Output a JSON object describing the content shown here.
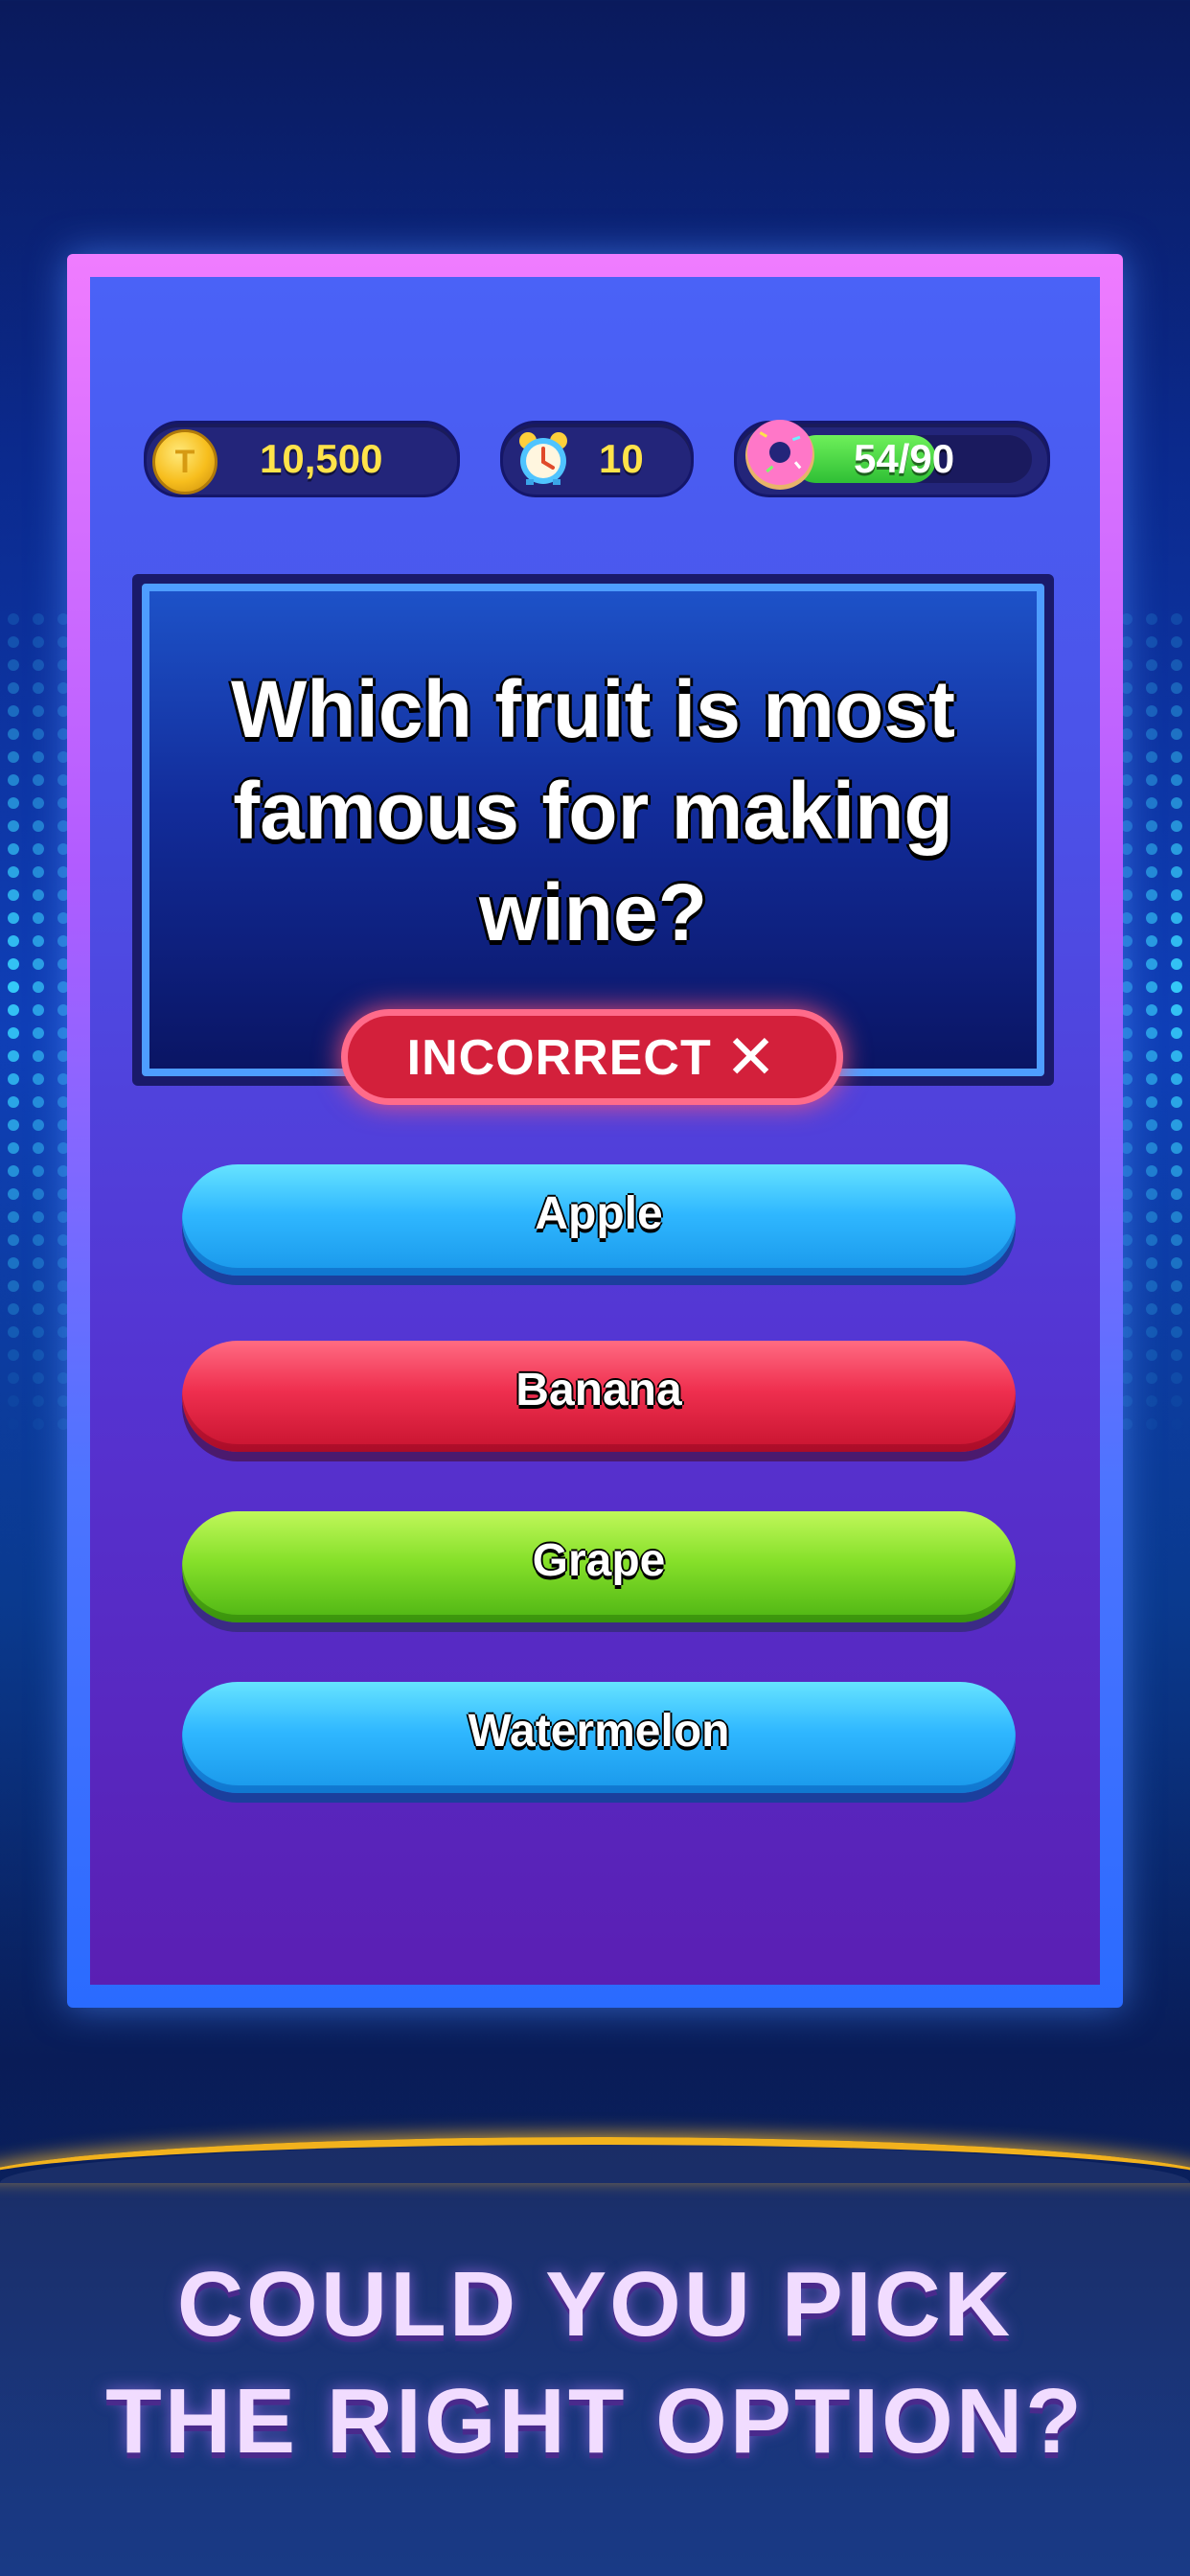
{
  "stats": {
    "coins": "10,500",
    "timer": "10",
    "progress_label": "54/90",
    "progress_fraction": 0.6
  },
  "question": {
    "text": "Which fruit is most famous for making wine?"
  },
  "feedback": {
    "label": "INCORRECT",
    "icon": "✕",
    "color": "#d3203b"
  },
  "answers": [
    {
      "label": "Apple",
      "color": "blue"
    },
    {
      "label": "Banana",
      "color": "red"
    },
    {
      "label": "Grape",
      "color": "green"
    },
    {
      "label": "Watermelon",
      "color": "blue"
    }
  ],
  "banner": {
    "line1": "COULD YOU PICK",
    "line2": "THE RIGHT OPTION?"
  },
  "icons": {
    "coin": "coin-icon",
    "timer": "alarm-clock-icon",
    "progress": "donut-icon"
  }
}
